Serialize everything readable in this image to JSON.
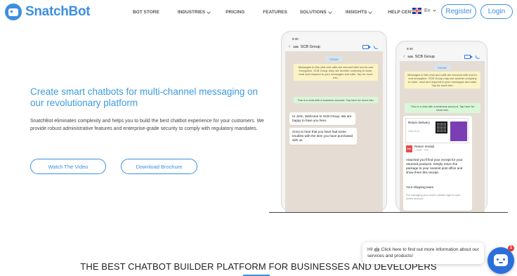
{
  "header": {
    "brand": "SnatchBot",
    "nav": [
      {
        "label": "BOT STORE",
        "dropdown": false
      },
      {
        "label": "INDUSTRIES",
        "dropdown": true
      },
      {
        "label": "PRICING",
        "dropdown": false
      },
      {
        "label": "FEATURES",
        "dropdown": false
      },
      {
        "label": "SOLUTIONS",
        "dropdown": true
      },
      {
        "label": "INSIGHTS",
        "dropdown": true
      },
      {
        "label": "HELP CENTER",
        "dropdown": false
      }
    ],
    "language": "En",
    "register_label": "Register",
    "login_label": "Login"
  },
  "hero": {
    "title": "Create smart chatbots for multi-channel messaging on our revolutionary platform",
    "description": "SnatchBot eliminates complexity and helps you to build the best chatbot experience for your customers. We provide robust administrative features and enterprise-grade security to comply with regulatory mandates.",
    "watch_video_label": "Watch The Video",
    "download_brochure_label": "Download Brochure"
  },
  "phone_back": {
    "time": "9:40",
    "contact": "SCB Group",
    "logo_text": "SCB",
    "today": "TODAY",
    "encryption": "Messages to this chat and calls are secured with end-to-end encryption. SCB Group may use another company to store, read and respond to your messages and calls. Tap for more info.",
    "business": "This is a chat with a business account. Tap here for more info.",
    "msg1": "Hi John. Welcome to SCB Group. We are happy to have you here.",
    "msg2": "Sorry to hear that you have had some troubles with the item you have purchased with us."
  },
  "phone_front": {
    "time": "9:40",
    "contact": "SCB Group",
    "logo_text": "SCB",
    "today": "TODAY",
    "encryption": "Messages to this chat and calls are secured with end-to-end encryption. SCB Group may use another company to store, read and respond to your messages and calls. Tap for more info.",
    "business": "This is a chat with a business account. Tap here for more info.",
    "card_title": "Return Delivery",
    "card_meta": "2018-09-23",
    "file_name": "Return receipt",
    "file_meta": "1 PAGE · PDF",
    "pdf_label": "PDF",
    "message": "Attached you'll find your receipt for your returned products. Simply return the package to your nearest post office and show them this receipt.",
    "signoff": "Your shipping team",
    "footer": "For managing your orders please login to your online account."
  },
  "bottom": {
    "title": "THE BEST CHATBOT BUILDER PLATFORM FOR BUSINESSES AND DEVELOPERS"
  },
  "chat_widget": {
    "tip": "Hi! 🤖 Click here to find out more information about our services and products!",
    "badge": "1"
  },
  "colors": {
    "brand_blue": "#3d8fe0",
    "title_blue": "#3d9be0",
    "fab_blue": "#2b6fdc",
    "badge_red": "#e53935"
  }
}
